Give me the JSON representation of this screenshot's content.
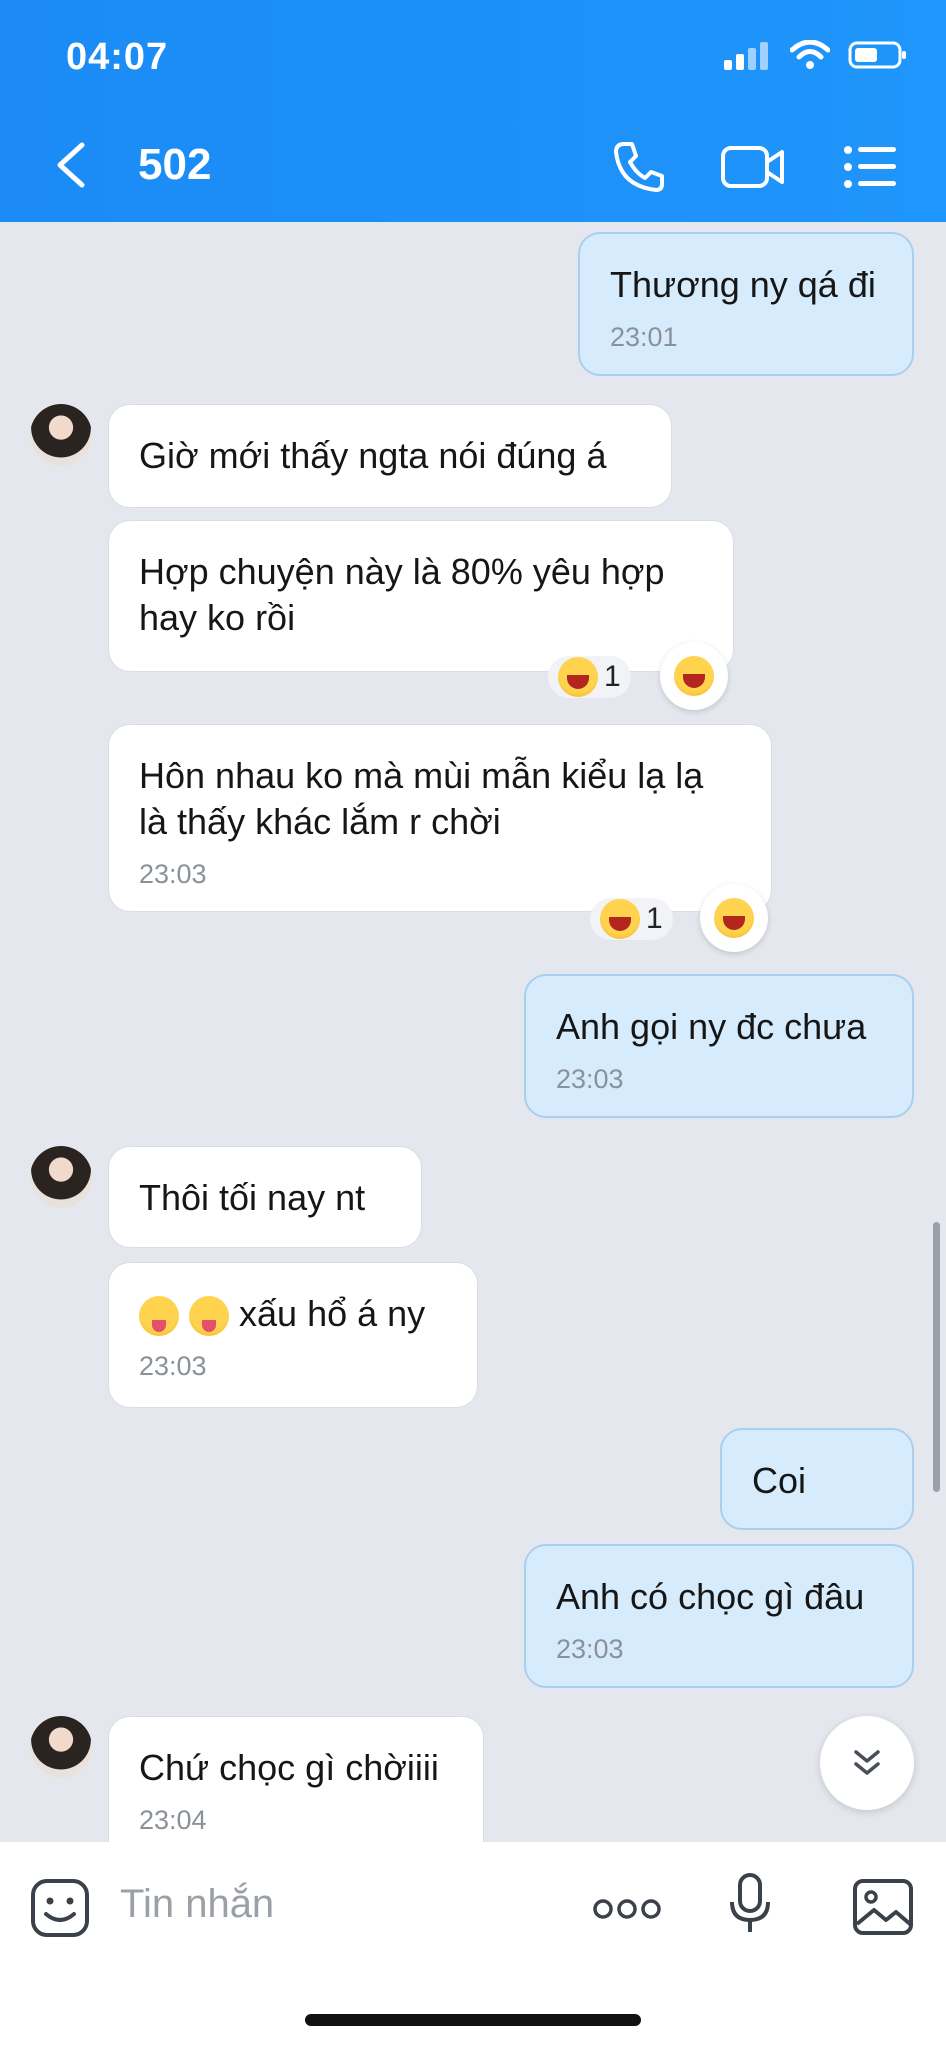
{
  "status_bar": {
    "time": "04:07"
  },
  "header": {
    "title": "502"
  },
  "messages": [
    {
      "text": "Thương ny qá đi",
      "time": "23:01"
    },
    {
      "text": "Giờ mới thấy ngta nói đúng á"
    },
    {
      "line1": "Hợp chuyện này là 80% yêu hợp",
      "line2": "hay ko rồi",
      "reaction_count": "1"
    },
    {
      "line1": "Hôn nhau ko mà mùi mẫn kiểu lạ lạ",
      "line2": "là thấy khác lắm r chời",
      "time": "23:03",
      "reaction_count": "1"
    },
    {
      "text": "Anh gọi ny đc chưa",
      "time": "23:03"
    },
    {
      "text": "Thôi tối nay nt"
    },
    {
      "text": "xấu hổ á ny",
      "time": "23:03"
    },
    {
      "text": "Coi"
    },
    {
      "text": "Anh có chọc gì đâu",
      "time": "23:03"
    },
    {
      "text": "Chứ chọc gì chờiiii",
      "time": "23:04"
    }
  ],
  "composer": {
    "placeholder": "Tin nhắn"
  },
  "colors": {
    "header": "#1f8ffa",
    "chat_bg": "#e4e8ee",
    "incoming": "#ffffff",
    "outgoing": "#d6ecfd"
  },
  "icons": [
    "back-icon",
    "phone-icon",
    "video-call-icon",
    "menu-icon",
    "emoji-sticker-icon",
    "more-icon",
    "microphone-icon",
    "image-icon",
    "scroll-down-icon"
  ]
}
